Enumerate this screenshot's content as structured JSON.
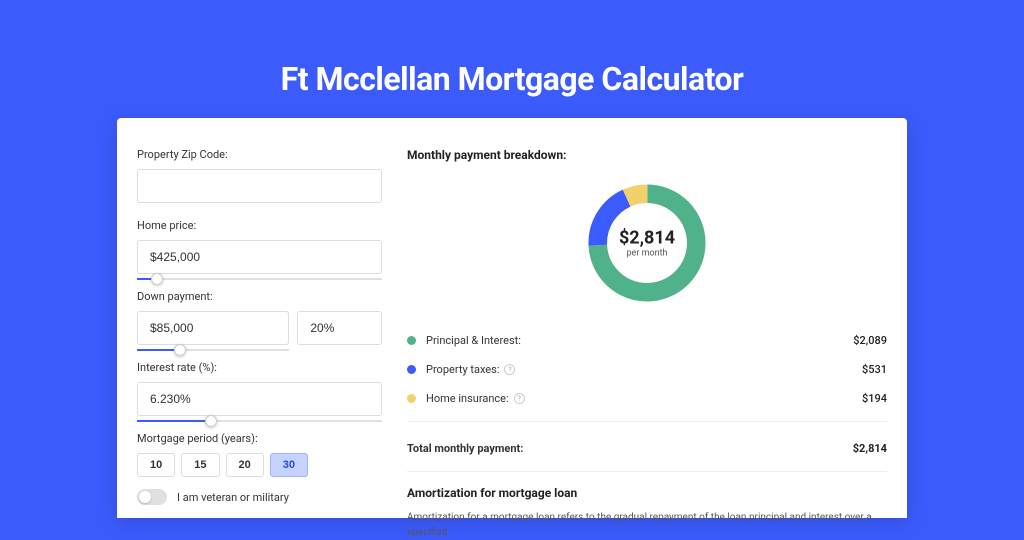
{
  "title": "Ft Mcclellan Mortgage Calculator",
  "form": {
    "zip_label": "Property Zip Code:",
    "zip_value": "",
    "home_price_label": "Home price:",
    "home_price_value": "$425,000",
    "home_price_slider_pct": 8,
    "down_payment_label": "Down payment:",
    "down_payment_value": "$85,000",
    "down_payment_pct_value": "20%",
    "down_payment_slider_pct": 28,
    "interest_label": "Interest rate (%):",
    "interest_value": "6.230%",
    "interest_slider_pct": 30,
    "period_label": "Mortgage period (years):",
    "period_options": [
      "10",
      "15",
      "20",
      "30"
    ],
    "period_selected": "30",
    "veteran_label": "I am veteran or military"
  },
  "breakdown": {
    "title": "Monthly payment breakdown:",
    "center_amount": "$2,814",
    "center_sub": "per month",
    "items": [
      {
        "label": "Principal & Interest:",
        "value": "$2,089",
        "color": "#4fb28a",
        "has_info": false
      },
      {
        "label": "Property taxes:",
        "value": "$531",
        "color": "#3b5bfd",
        "has_info": true
      },
      {
        "label": "Home insurance:",
        "value": "$194",
        "color": "#f2d06b",
        "has_info": true
      }
    ],
    "total_label": "Total monthly payment:",
    "total_value": "$2,814"
  },
  "amortization": {
    "title": "Amortization for mortgage loan",
    "text": "Amortization for a mortgage loan refers to the gradual repayment of the loan principal and interest over a specified"
  },
  "chart_data": {
    "type": "pie",
    "title": "Monthly payment breakdown",
    "series": [
      {
        "name": "Principal & Interest",
        "value": 2089,
        "color": "#4fb28a"
      },
      {
        "name": "Property taxes",
        "value": 531,
        "color": "#3b5bfd"
      },
      {
        "name": "Home insurance",
        "value": 194,
        "color": "#f2d06b"
      }
    ],
    "total": 2814,
    "center_label": "$2,814 per month"
  }
}
